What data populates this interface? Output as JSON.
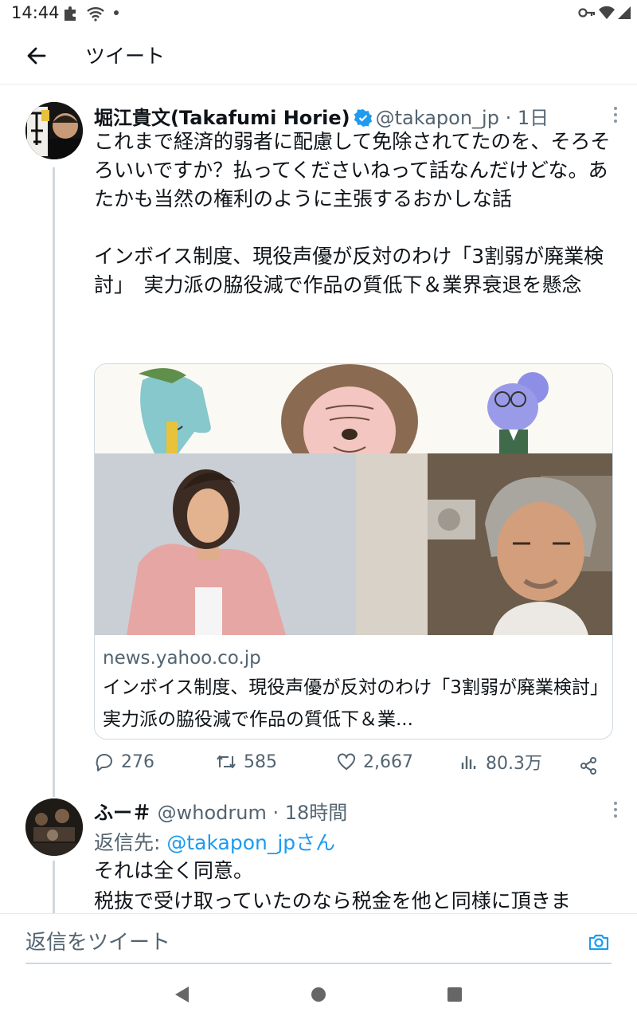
{
  "status_bar": {
    "time": "14:44"
  },
  "app_bar": {
    "title": "ツイート"
  },
  "tweet": {
    "author_name": "堀江貴文(Takafumi Horie)",
    "author_handle": "@takapon_jp · 1日",
    "text": "これまで経済的弱者に配慮して免除されてたのを、そろそろいいですか？払ってくださいねって話なんだけどな。あたかも当然の権利のように主張するおかしな話\n\nインボイス制度、現役声優が反対のわけ「3割弱が廃業検討」　実力派の脇役減で作品の質低下＆業界衰退を懸念",
    "card": {
      "domain": "news.yahoo.co.jp",
      "title": "インボイス制度、現役声優が反対のわけ「3割弱が廃業検討」　実力派の脇役減で作品の質低下＆業..."
    },
    "actions": {
      "replies": "276",
      "retweets": "585",
      "likes": "2,667",
      "views": "80.3万"
    }
  },
  "reply": {
    "author_name": "ふー＃",
    "author_handle": "@whodrum · 18時間",
    "reply_to_prefix": "返信先: ",
    "reply_to_handle": "@takapon_jpさん",
    "text": "それは全く同意。\n税抜で受け取っていたのなら税金を他と同様に頂きま"
  },
  "composer": {
    "placeholder": "返信をツイート"
  },
  "colors": {
    "accent": "#1d9bf0",
    "secondary_text": "#536471",
    "divider": "#cfd9de"
  }
}
